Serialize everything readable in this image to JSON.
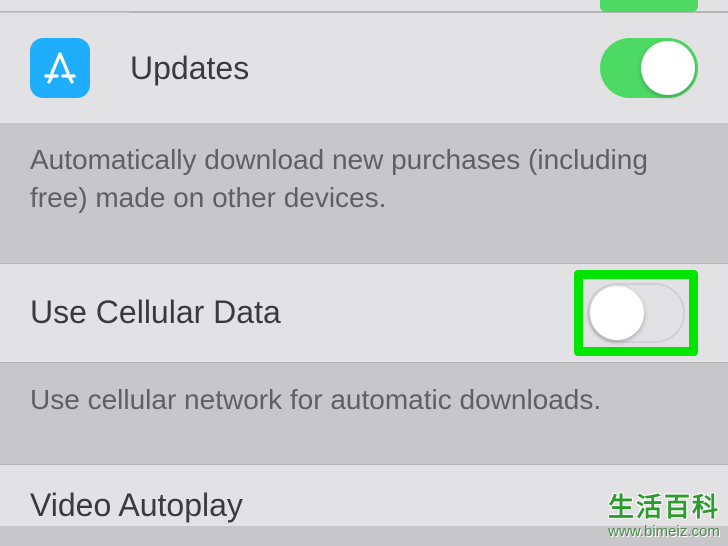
{
  "rows": {
    "updates": {
      "label": "Updates",
      "toggle_on": true
    },
    "auto_download_footer": "Automatically download new purchases (including free) made on other devices.",
    "cellular": {
      "label": "Use Cellular Data",
      "toggle_on": false
    },
    "cellular_footer": "Use cellular network for automatic downloads.",
    "video_autoplay": {
      "label": "Video Autoplay"
    }
  },
  "watermark": {
    "cn": "生活百科",
    "url": "www.bimeiz.com"
  }
}
